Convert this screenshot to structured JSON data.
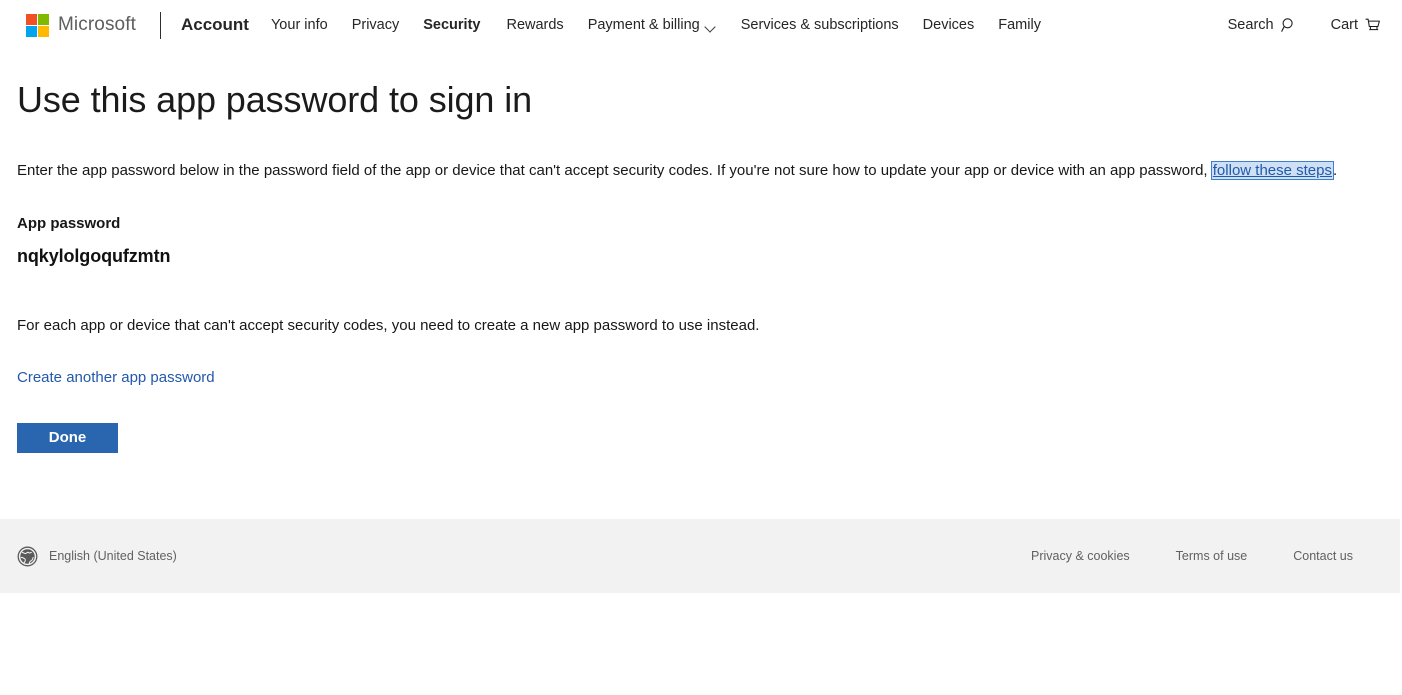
{
  "header": {
    "brand_name": "Microsoft",
    "logo_colors": {
      "top_left": "#f25022",
      "top_right": "#7fba00",
      "bottom_left": "#00a4ef",
      "bottom_right": "#ffb900"
    },
    "product": "Account",
    "nav_items": [
      {
        "label": "Your info",
        "bold": false,
        "has_chevron": false
      },
      {
        "label": "Privacy",
        "bold": false,
        "has_chevron": false
      },
      {
        "label": "Security",
        "bold": true,
        "has_chevron": false
      },
      {
        "label": "Rewards",
        "bold": false,
        "has_chevron": false
      },
      {
        "label": "Payment & billing",
        "bold": false,
        "has_chevron": true
      },
      {
        "label": "Services & subscriptions",
        "bold": false,
        "has_chevron": false
      },
      {
        "label": "Devices",
        "bold": false,
        "has_chevron": false
      },
      {
        "label": "Family",
        "bold": false,
        "has_chevron": false
      }
    ],
    "search_label": "Search",
    "cart_label": "Cart"
  },
  "main": {
    "title": "Use this app password to sign in",
    "intro_before_link": "Enter the app password below in the password field of the app or device that can't accept security codes. If you're not sure how to update your app or device with an app password, ",
    "intro_link": "follow these steps",
    "intro_after_link": ".",
    "password_label": "App password",
    "password_value": "nqkylolgoqufzmtn",
    "note": "For each app or device that can't accept security codes, you need to create a new app password to use instead.",
    "create_another_link": "Create another app password",
    "done_button": "Done",
    "accent_color": "#2a65b0",
    "link_color": "#2358ac"
  },
  "footer": {
    "language": "English (United States)",
    "links": [
      {
        "label": "Privacy & cookies"
      },
      {
        "label": "Terms of use"
      },
      {
        "label": "Contact us"
      }
    ]
  }
}
